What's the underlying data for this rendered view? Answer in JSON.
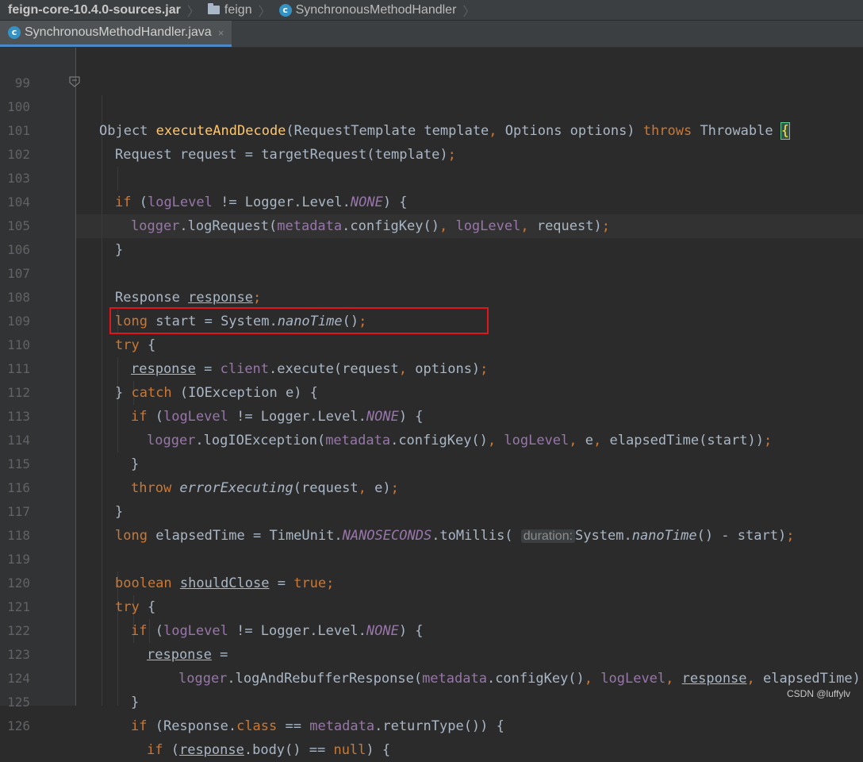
{
  "breadcrumbs": [
    "feign-core-10.4.0-sources.jar",
    "feign",
    "SynchronousMethodHandler"
  ],
  "tab": {
    "label": "SynchronousMethodHandler.java",
    "close": "×"
  },
  "line_numbers": [
    "99",
    "100",
    "101",
    "102",
    "103",
    "104",
    "105",
    "106",
    "107",
    "108",
    "109",
    "110",
    "111",
    "112",
    "113",
    "114",
    "115",
    "116",
    "117",
    "118",
    "119",
    "120",
    "121",
    "122",
    "123",
    "124",
    "125",
    "126"
  ],
  "code_lines": [
    "",
    "Object executeAndDecode(RequestTemplate template, Options options) throws Throwable {",
    "  Request request = targetRequest(template);",
    "",
    "  if (logLevel != Logger.Level.NONE) {",
    "    logger.logRequest(metadata.configKey(), logLevel, request);",
    "  }",
    "",
    "  Response response;",
    "  long start = System.nanoTime();",
    "  try {",
    "    response = client.execute(request, options);",
    "  } catch (IOException e) {",
    "    if (logLevel != Logger.Level.NONE) {",
    "      logger.logIOException(metadata.configKey(), logLevel, e, elapsedTime(start));",
    "    }",
    "    throw errorExecuting(request, e);",
    "  }",
    "  long elapsedTime = TimeUnit.NANOSECONDS.toMillis(duration: System.nanoTime() - start);",
    "",
    "  boolean shouldClose = true;",
    "  try {",
    "    if (logLevel != Logger.Level.NONE) {",
    "      response =",
    "          logger.logAndRebufferResponse(metadata.configKey(), logLevel, response, elapsedTime);",
    "    }",
    "    if (Response.class == metadata.returnType()) {",
    "      if (response.body() == null) {"
  ],
  "param_hint": "duration:",
  "highlighted_line": "110",
  "watermark": "CSDN @luffylv",
  "colors": {
    "keyword": "#cc7832",
    "method_decl": "#ffc66d",
    "field": "#9876aa",
    "text": "#a9b7c6",
    "highlight_box": "#e0161c"
  }
}
